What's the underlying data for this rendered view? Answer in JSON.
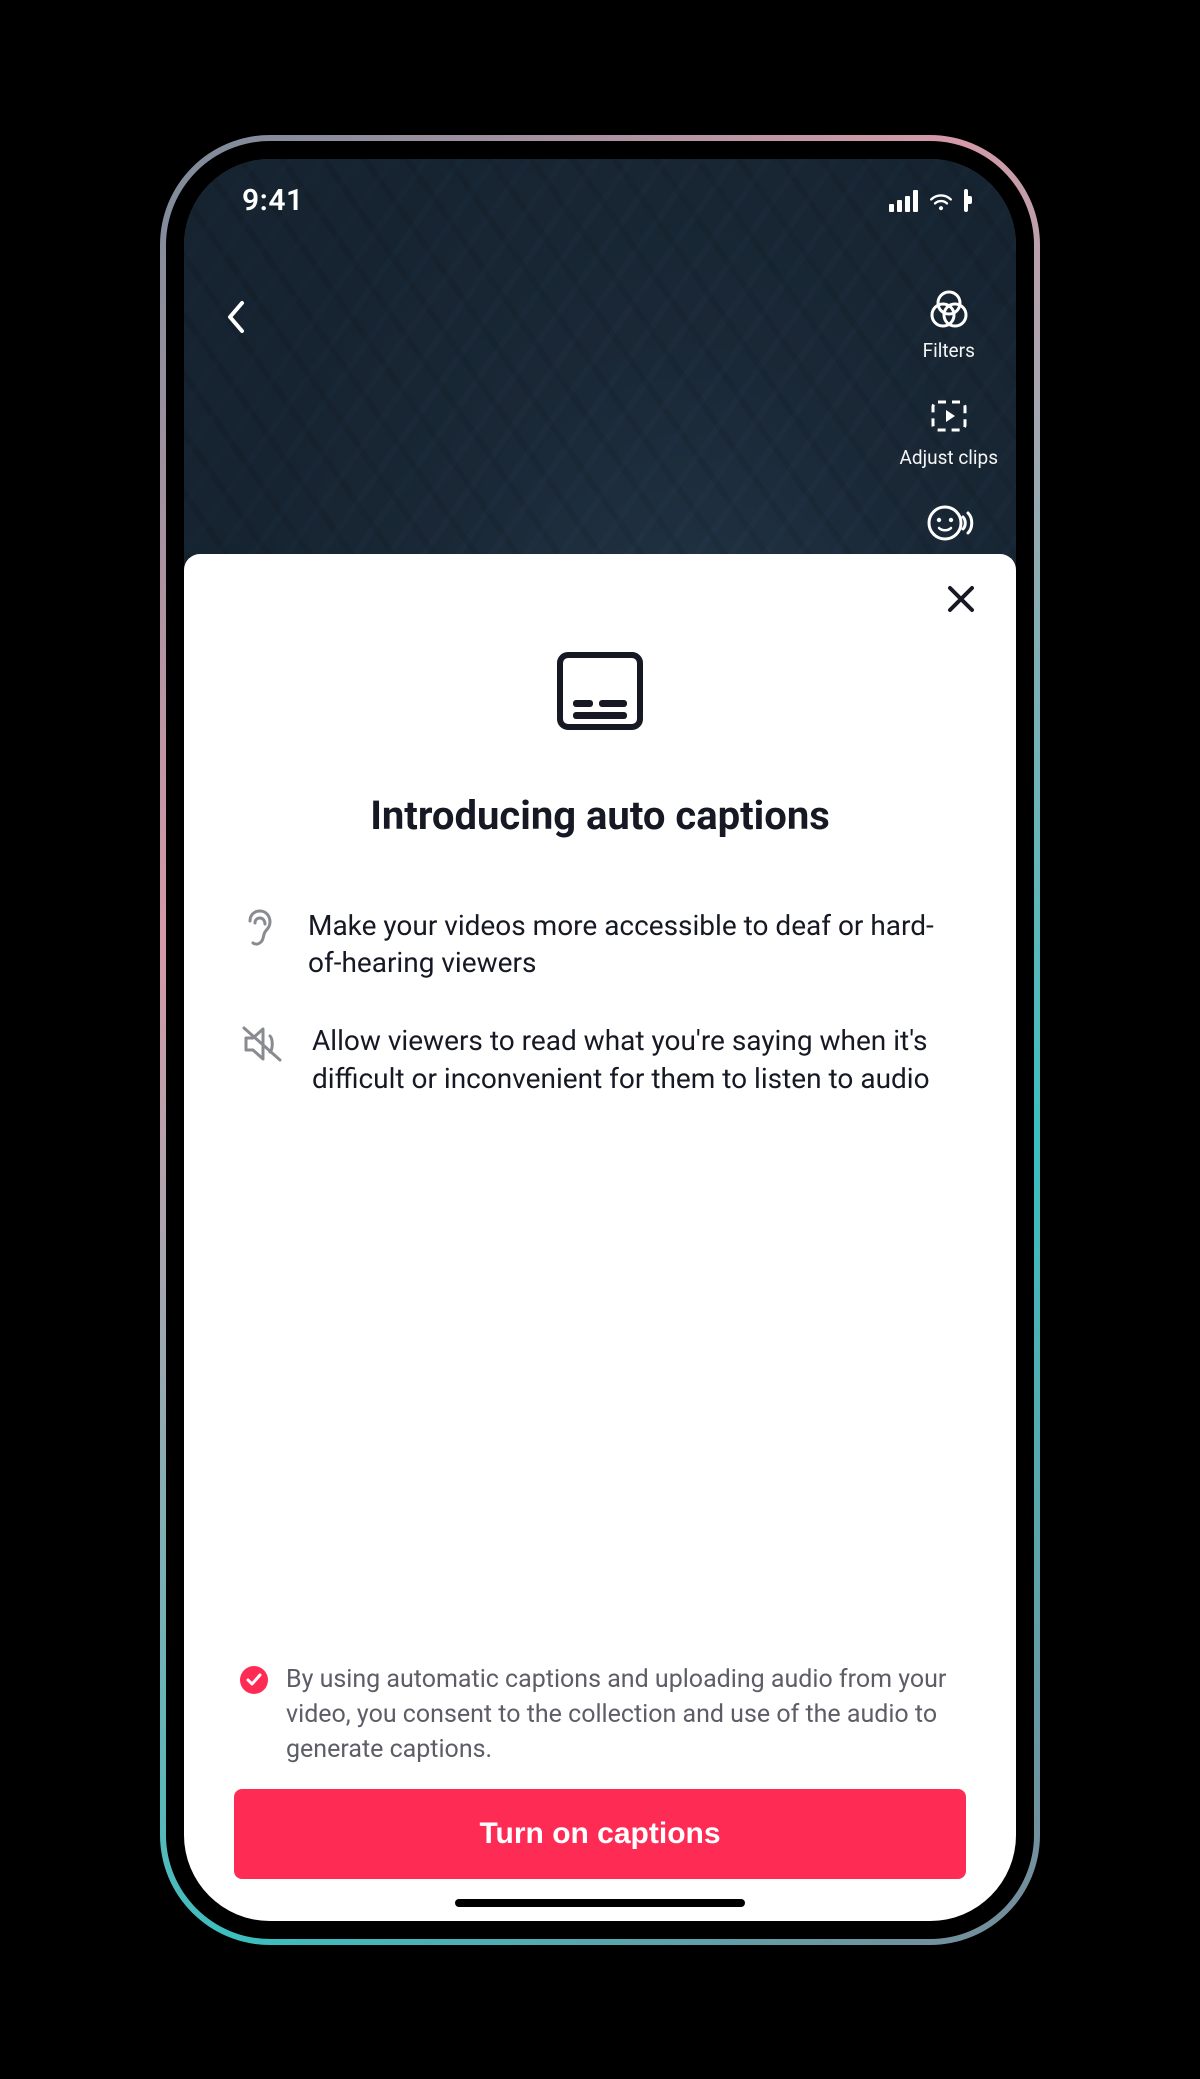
{
  "status": {
    "time": "9:41"
  },
  "tools": {
    "filters": "Filters",
    "adjust_clips": "Adjust clips"
  },
  "sheet": {
    "title": "Introducing auto captions",
    "benefit1": "Make your videos more accessible to deaf or hard-of-hearing viewers",
    "benefit2": "Allow viewers to read what you're saying when it's difficult or inconvenient for them to listen to audio",
    "consent": "By using automatic captions and uploading audio from your video, you consent to the collection and use of the audio to generate captions.",
    "cta": "Turn on captions"
  },
  "colors": {
    "accent": "#fe2c55"
  }
}
